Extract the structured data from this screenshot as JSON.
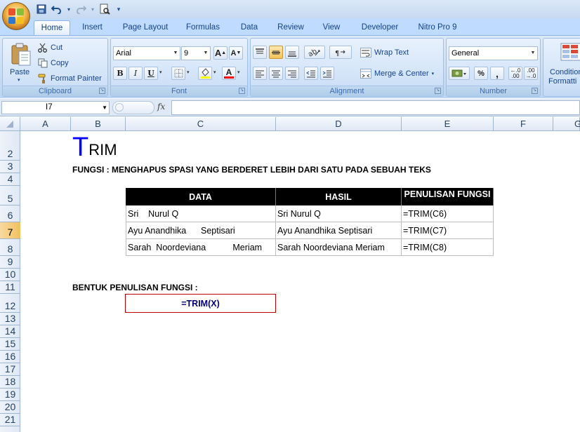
{
  "qat": {
    "icons": [
      "save-icon",
      "undo-icon",
      "redo-icon",
      "print-preview-icon",
      "customize-icon"
    ]
  },
  "tabs": [
    "Home",
    "Insert",
    "Page Layout",
    "Formulas",
    "Data",
    "Review",
    "View",
    "Developer",
    "Nitro Pro 9"
  ],
  "active_tab": "Home",
  "clipboard": {
    "paste": "Paste",
    "cut": "Cut",
    "copy": "Copy",
    "format_painter": "Format Painter",
    "label": "Clipboard"
  },
  "font": {
    "name": "Arial",
    "size": "9",
    "bold": "B",
    "italic": "I",
    "underline": "U",
    "font_color_letter": "A",
    "fill_color": "#ffff00",
    "font_color": "#ff0000",
    "grow": "A",
    "shrink": "A",
    "label": "Font"
  },
  "alignment": {
    "wrap_text": "Wrap Text",
    "merge_center": "Merge & Center",
    "label": "Alignment"
  },
  "number": {
    "format": "General",
    "percent": "%",
    "comma": ",",
    "inc_decimal": ".00",
    "dec_decimal": ".00",
    "label": "Number"
  },
  "styles": {
    "conditional_formatting_1": "Condition",
    "conditional_formatting_2": "Formatti"
  },
  "formula_bar": {
    "name_box": "I7",
    "fx": "fx",
    "formula": ""
  },
  "columns": [
    "A",
    "B",
    "C",
    "D",
    "E",
    "F",
    "G"
  ],
  "selected_column": "I",
  "rows": [
    "2",
    "3",
    "4",
    "5",
    "6",
    "7",
    "8",
    "9",
    "10",
    "11",
    "12",
    "13",
    "14",
    "15",
    "16",
    "17",
    "18",
    "19",
    "20",
    "21"
  ],
  "selected_row": "7",
  "sheet": {
    "title_first": "T",
    "title_rest": "RIM",
    "fungsi": "FUNGSI : MENGHAPUS SPASI YANG BERDERET LEBIH DARI SATU PADA SEBUAH TEKS",
    "table": {
      "headers": [
        "DATA",
        "HASIL",
        "PENULISAN FUNGSI"
      ],
      "rows": [
        [
          "Sri    Nurul Q",
          "Sri Nurul Q",
          "=TRIM(C6)"
        ],
        [
          "Ayu Anandhika      Septisari",
          "Ayu Anandhika Septisari",
          "=TRIM(C7)"
        ],
        [
          "Sarah  Noordeviana           Meriam",
          "Sarah Noordeviana Meriam",
          "=TRIM(C8)"
        ]
      ]
    },
    "bentuk_label": "BENTUK PENULISAN FUNGSI :",
    "bentuk_formula": "=TRIM(X)"
  },
  "colors": {
    "accent_blue": "#0000ff",
    "formula_border": "#c00000",
    "formula_text": "#000080"
  }
}
